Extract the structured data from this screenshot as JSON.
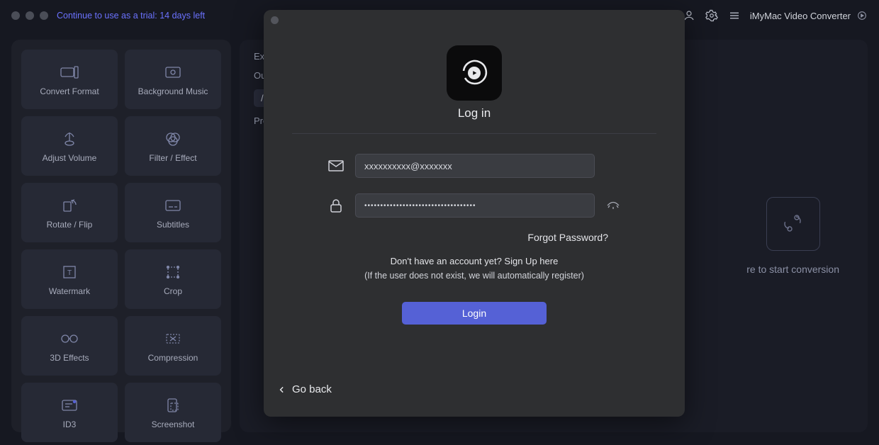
{
  "titlebar": {
    "trial_text": "Continue to use as a trial: 14 days left",
    "app_name": "iMyMac Video Converter"
  },
  "sidebar": {
    "tiles": [
      {
        "label": "Convert Format",
        "icon": "convert"
      },
      {
        "label": "Background Music",
        "icon": "music"
      },
      {
        "label": "Adjust Volume",
        "icon": "volume"
      },
      {
        "label": "Filter / Effect",
        "icon": "filter"
      },
      {
        "label": "Rotate / Flip",
        "icon": "rotate"
      },
      {
        "label": "Subtitles",
        "icon": "subtitles"
      },
      {
        "label": "Watermark",
        "icon": "watermark"
      },
      {
        "label": "Crop",
        "icon": "crop"
      },
      {
        "label": "3D Effects",
        "icon": "3d"
      },
      {
        "label": "Compression",
        "icon": "compress"
      },
      {
        "label": "ID3",
        "icon": "id3"
      },
      {
        "label": "Screenshot",
        "icon": "screenshot"
      }
    ]
  },
  "main": {
    "export_label": "Expo",
    "output_label": "Outp",
    "output_path": "/U",
    "project_label": "Proj",
    "drop_hint": "re to start conversion"
  },
  "modal": {
    "title": "Log in",
    "email_value": "xxxxxxxxxx@xxxxxxx",
    "password_value": "•••••••••••••••••••••••••••••••••••",
    "forgot": "Forgot Password?",
    "signup_line": "Don't have an account yet? Sign Up here",
    "register_note": "(If the user does not exist, we will automatically register)",
    "login_btn": "Login",
    "go_back": "Go back"
  }
}
